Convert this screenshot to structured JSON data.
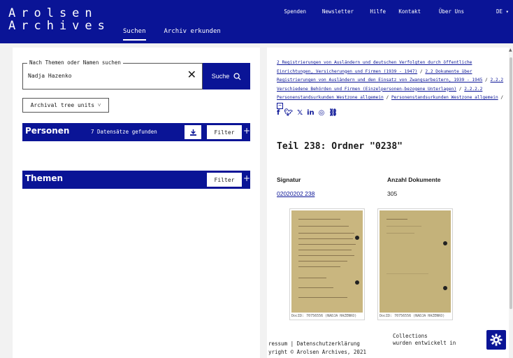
{
  "header": {
    "logo_line1": "Arolsen",
    "logo_line2": "Archives",
    "nav_suchen": "Suchen",
    "nav_archiv": "Archiv erkunden",
    "top_spenden": "Spenden",
    "top_newsletter": "Newsletter",
    "top_hilfe": "Hilfe",
    "top_kontakt": "Kontakt",
    "top_ueber": "Über Uns",
    "top_lang": "DE"
  },
  "search": {
    "legend": "Nach Themen oder Namen suchen",
    "value": "Nadja Hazenko",
    "button_label": "Suche",
    "tree_button": "Archival tree units"
  },
  "personen": {
    "title": "Personen",
    "count": "7 Datensätze gefunden",
    "filter": "Filter"
  },
  "themen": {
    "title": "Themen",
    "filter": "Filter"
  },
  "record": {
    "breadcrumb": [
      "2 Registrierungen von Ausländern und deutschen Verfolgten durch öffentliche Einrichtungen, Versicherungen und Firmen (1939 - 1947)",
      "2.2 Dokumente über Registrierungen von Ausländern und den Einsatz von Zwangsarbeitern, 1939 - 1945",
      "2.2.2 Verschiedene Behörden und Firmen (Einzelpersonen-bezogene Unterlagen)",
      "2.2.2.2 Personenstandsurkunden Westzone allgemein",
      "Personenstandsurkunden Westzone allgemein"
    ],
    "title": "Teil 238: Ordner \"0238\"",
    "signatur_label": "Signatur",
    "signatur_value": "02020202 238",
    "anzahl_label": "Anzahl Dokumente",
    "anzahl_value": "305",
    "doc1_caption": "DocID: 70756556 (NADJA HAZENKO)",
    "doc2_caption": "DocID: 70756556 (NADJA HAZENKO)"
  },
  "footer": {
    "left_line1": "ressum | Datenschutzerklärung",
    "left_line2": "yright © Arolsen Archives, 2021",
    "right_line1": "Collections",
    "right_line2": "wurden entwickelt in"
  },
  "colors": {
    "brand": "#0a1496"
  }
}
